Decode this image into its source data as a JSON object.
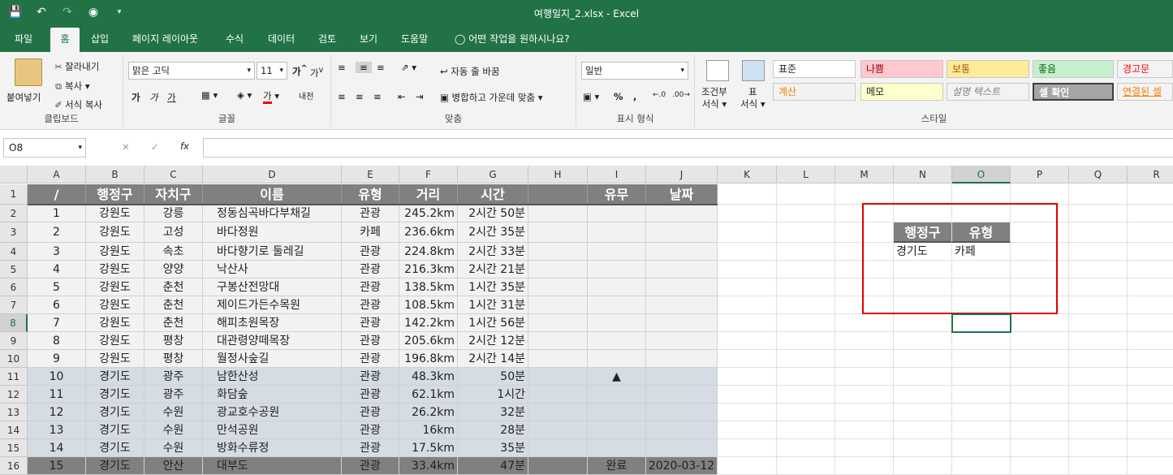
{
  "window": {
    "title": "여행일지_2.xlsx  -  Excel"
  },
  "tabs": [
    "파일",
    "홈",
    "삽입",
    "페이지 레이아웃",
    "수식",
    "데이터",
    "검토",
    "보기",
    "도움말"
  ],
  "tell_me": "어떤 작업을 원하시나요?",
  "ribbon": {
    "clipboard": {
      "paste": "붙여넣기",
      "cut": "잘라내기",
      "copy": "복사",
      "format_painter": "서식 복사",
      "label": "클립보드"
    },
    "font": {
      "name": "맑은 고딕",
      "size": "11",
      "label": "글꼴",
      "grow": "가",
      "shrink": "가",
      "bold": "가",
      "italic": "가",
      "underline": "가",
      "color_a": "가",
      "phonetic": "내천"
    },
    "alignment": {
      "wrap": "자동 줄 바꿈",
      "merge": "병합하고 가운데 맞춤",
      "label": "맞춤"
    },
    "number": {
      "format": "일반",
      "percent": "%",
      "comma": ",",
      "label": "표시 형식"
    },
    "styles": {
      "cond": "조건부\n서식",
      "cond_l1": "조건부",
      "cond_l2": "서식",
      "table_l1": "표",
      "table_l2": "서식",
      "label": "스타일",
      "cells": [
        {
          "text": "표준",
          "bg": "#ffffff",
          "color": "#222222"
        },
        {
          "text": "나쁨",
          "bg": "#ffc7ce",
          "color": "#9c0006"
        },
        {
          "text": "보통",
          "bg": "#ffeb9c",
          "color": "#9c5700"
        },
        {
          "text": "좋음",
          "bg": "#c6efce",
          "color": "#006100"
        },
        {
          "text": "경고문",
          "bg": "#f3f3f3",
          "color": "#ff0000"
        },
        {
          "text": "계산",
          "bg": "#f2f2f2",
          "color": "#fa7d00"
        },
        {
          "text": "메모",
          "bg": "#ffffcc",
          "color": "#222222"
        },
        {
          "text": "설명 텍스트",
          "bg": "#f3f3f3",
          "color": "#7f7f7f"
        },
        {
          "text": "셀 확인",
          "bg": "#a5a5a5",
          "color": "#ffffff"
        },
        {
          "text": "연결된 셀",
          "bg": "#f3f3f3",
          "color": "#fa7d00"
        }
      ]
    }
  },
  "formula_bar": {
    "name_box": "O8",
    "fx": "fx",
    "value": ""
  },
  "columns": [
    "A",
    "B",
    "C",
    "D",
    "E",
    "F",
    "G",
    "H",
    "I",
    "J",
    "K",
    "L",
    "M",
    "N",
    "O",
    "P",
    "Q",
    "R"
  ],
  "selected_column": "O",
  "selected_row": "8",
  "table_header": [
    "/",
    "행정구",
    "자치구",
    "이름",
    "유형",
    "거리",
    "시간",
    "",
    "유무",
    "날짜"
  ],
  "rows": [
    [
      "1",
      "강원도",
      "강릉",
      "정동심곡바다부채길",
      "관광",
      "245.2km",
      "2시간 50분",
      "",
      "",
      ""
    ],
    [
      "2",
      "강원도",
      "고성",
      "바다정원",
      "카페",
      "236.6km",
      "2시간 35분",
      "",
      "",
      ""
    ],
    [
      "3",
      "강원도",
      "속초",
      "바다향기로 둘레길",
      "관광",
      "224.8km",
      "2시간 33분",
      "",
      "",
      ""
    ],
    [
      "4",
      "강원도",
      "양양",
      "낙산사",
      "관광",
      "216.3km",
      "2시간 21분",
      "",
      "",
      ""
    ],
    [
      "5",
      "강원도",
      "춘천",
      "구봉산전망대",
      "관광",
      "138.5km",
      "1시간 35분",
      "",
      "",
      ""
    ],
    [
      "6",
      "강원도",
      "춘천",
      "제이드가든수목원",
      "관광",
      "108.5km",
      "1시간 31분",
      "",
      "",
      ""
    ],
    [
      "7",
      "강원도",
      "춘천",
      "해피초원목장",
      "관광",
      "142.2km",
      "1시간 56분",
      "",
      "",
      ""
    ],
    [
      "8",
      "강원도",
      "평창",
      "대관령양떼목장",
      "관광",
      "205.6km",
      "2시간 12분",
      "",
      "",
      ""
    ],
    [
      "9",
      "강원도",
      "평창",
      "월정사숲길",
      "관광",
      "196.8km",
      "2시간 14분",
      "",
      "",
      ""
    ],
    [
      "10",
      "경기도",
      "광주",
      "남한산성",
      "관광",
      "48.3km",
      "50분",
      "",
      "▲",
      ""
    ],
    [
      "11",
      "경기도",
      "광주",
      "화담숲",
      "관광",
      "62.1km",
      "1시간",
      "",
      "",
      ""
    ],
    [
      "12",
      "경기도",
      "수원",
      "광교호수공원",
      "관광",
      "26.2km",
      "32분",
      "",
      "",
      ""
    ],
    [
      "13",
      "경기도",
      "수원",
      "만석공원",
      "관광",
      "16km",
      "28분",
      "",
      "",
      ""
    ],
    [
      "14",
      "경기도",
      "수원",
      "방화수류정",
      "관광",
      "17.5km",
      "35분",
      "",
      "",
      ""
    ],
    [
      "15",
      "경기도",
      "안산",
      "대부도",
      "관광",
      "33.4km",
      "47분",
      "",
      "완료",
      "2020-03-12"
    ]
  ],
  "criteria": {
    "headers": [
      "행정구",
      "유형"
    ],
    "values": [
      "경기도",
      "카페"
    ]
  }
}
